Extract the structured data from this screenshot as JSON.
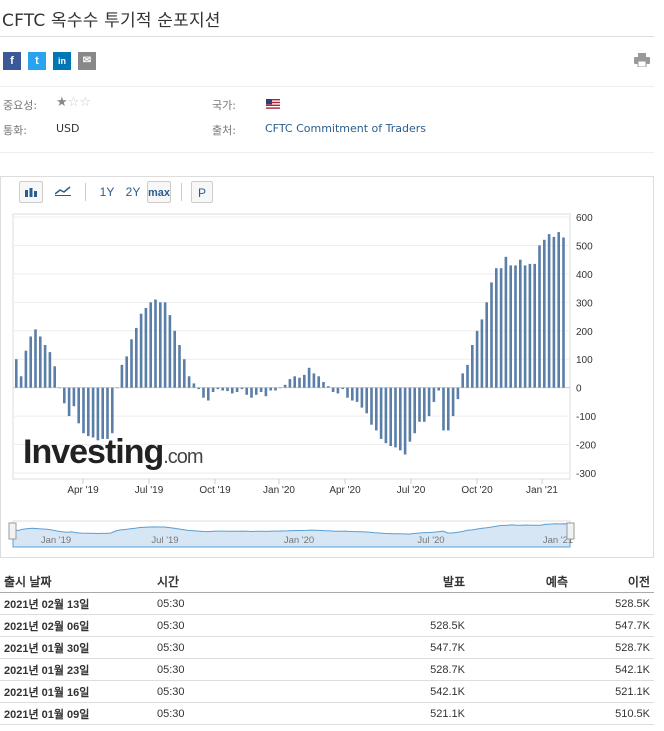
{
  "page": {
    "title": "CFTC 옥수수 투기적 순포지션"
  },
  "share": {
    "facebook": "f",
    "twitter": "t",
    "linkedin": "in",
    "email": "✉"
  },
  "meta": {
    "importance_label": "중요성:",
    "importance_stars": 1,
    "importance_stars_max": 3,
    "country_label": "국가:",
    "country_flag": "us-flag-icon",
    "currency_label": "통화:",
    "currency_value": "USD",
    "source_label": "출처:",
    "source_value": "CFTC Commitment of Traders"
  },
  "toolbar": {
    "range_1y": "1Y",
    "range_2y": "2Y",
    "range_max": "max",
    "p_label": "P"
  },
  "colors": {
    "bar": "#5a7ea8",
    "link": "#2a5d8f",
    "navigator_fill": "#d6e6f5",
    "navigator_line": "#5a9fd4"
  },
  "chart_data": {
    "type": "bar",
    "y_ticks": [
      600,
      500,
      400,
      300,
      200,
      100,
      0,
      -100,
      -200,
      -300
    ],
    "ylim": [
      -300,
      600
    ],
    "x_tick_labels": [
      "Apr '19",
      "Jul '19",
      "Oct '19",
      "Jan '20",
      "Apr '20",
      "Jul '20",
      "Oct '20",
      "Jan '21"
    ],
    "values": [
      100,
      40,
      130,
      180,
      205,
      180,
      150,
      125,
      75,
      0,
      -55,
      -100,
      -65,
      -125,
      -160,
      -170,
      -175,
      -185,
      -180,
      -180,
      -160,
      0,
      80,
      110,
      170,
      210,
      260,
      280,
      300,
      310,
      300,
      300,
      255,
      200,
      150,
      100,
      40,
      15,
      -5,
      -35,
      -45,
      -15,
      -5,
      -10,
      -12,
      -20,
      -15,
      -5,
      -25,
      -35,
      -25,
      -15,
      -30,
      -10,
      -10,
      0,
      10,
      30,
      40,
      35,
      45,
      70,
      50,
      40,
      20,
      5,
      -15,
      -20,
      -5,
      -35,
      -45,
      -50,
      -70,
      -90,
      -130,
      -150,
      -180,
      -195,
      -205,
      -210,
      -220,
      -235,
      -190,
      -160,
      -120,
      -120,
      -100,
      -50,
      -10,
      -150,
      -150,
      -100,
      -40,
      50,
      80,
      150,
      200,
      240,
      300,
      370,
      420,
      420,
      460,
      430,
      430,
      450,
      430,
      435,
      435,
      500,
      520,
      540,
      530,
      547,
      528
    ],
    "watermark": "Investing.com"
  },
  "navigator": {
    "labels": [
      "Jan '19",
      "Jul '19",
      "Jan '20",
      "Jul '20",
      "Jan '21"
    ]
  },
  "table": {
    "headers": {
      "date": "출시 날짜",
      "time": "시간",
      "actual": "발표",
      "forecast": "예측",
      "previous": "이전"
    },
    "rows": [
      {
        "date": "2021년 02월 13일",
        "time": "05:30",
        "actual": "",
        "forecast": "",
        "previous": "528.5K"
      },
      {
        "date": "2021년 02월 06일",
        "time": "05:30",
        "actual": "528.5K",
        "forecast": "",
        "previous": "547.7K"
      },
      {
        "date": "2021년 01월 30일",
        "time": "05:30",
        "actual": "547.7K",
        "forecast": "",
        "previous": "528.7K"
      },
      {
        "date": "2021년 01월 23일",
        "time": "05:30",
        "actual": "528.7K",
        "forecast": "",
        "previous": "542.1K"
      },
      {
        "date": "2021년 01월 16일",
        "time": "05:30",
        "actual": "542.1K",
        "forecast": "",
        "previous": "521.1K"
      },
      {
        "date": "2021년 01월 09일",
        "time": "05:30",
        "actual": "521.1K",
        "forecast": "",
        "previous": "510.5K"
      }
    ]
  }
}
